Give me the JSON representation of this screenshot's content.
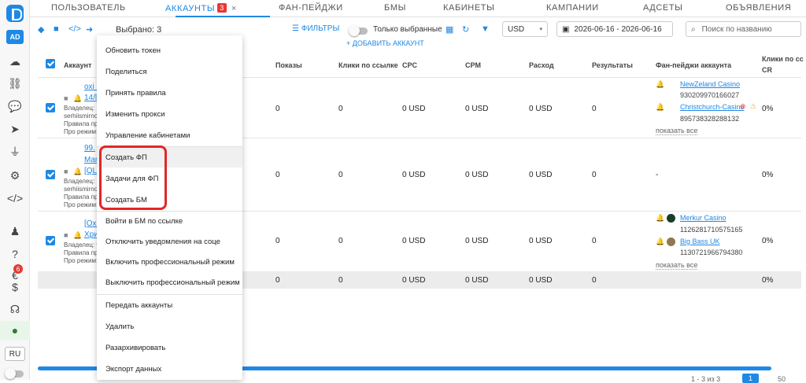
{
  "sidebar": {
    "ad_label": "AD",
    "ru_label": "RU",
    "badge_count": "6",
    "icons": [
      "cloud-upload-icon",
      "hierarchy-icon",
      "chat-icon",
      "cursor-icon",
      "plug-icon",
      "gear-icon",
      "code-icon",
      "user-spy-icon",
      "help-icon",
      "euro-icon",
      "dollar-icon",
      "headset-icon",
      "bulb-icon"
    ]
  },
  "tabs": [
    {
      "label": "ПОЛЬЗОВАТЕЛЬ"
    },
    {
      "label": "АККАУНТЫ",
      "badge": "3",
      "close": "×"
    },
    {
      "label": "ФАН-ПЕЙДЖИ"
    },
    {
      "label": "БМЫ"
    },
    {
      "label": "КАБИНЕТЫ"
    },
    {
      "label": "КАМПАНИИ"
    },
    {
      "label": "АДСЕТЫ"
    },
    {
      "label": "ОБЪЯВЛЕНИЯ"
    }
  ],
  "toolbar": {
    "selected": "Выбрано: 3",
    "filters": "ФИЛЬТРЫ",
    "only_selected": "Только выбранные",
    "add_account": "+ ДОБАВИТЬ АККАУНТ",
    "currency": "USD",
    "date_range": "2026-06-16 - 2026-06-16",
    "search_placeholder": "Поиск по названию"
  },
  "table": {
    "headers": {
      "account": "Аккаунт",
      "impressions": "Показы",
      "clicks": "Клики по ссылке",
      "cpc": "CPC",
      "cpm": "CPM",
      "spend": "Расход",
      "results": "Результаты",
      "fanpages": "Фан-пейджи аккаунта",
      "clicks_cut": "Клики по сс",
      "cr": "CR"
    },
    "rows": [
      {
        "name1": "oxi l",
        "name2": "14/l",
        "owner": "Владелец:",
        "owner_name": "serhiismirnov",
        "rules": "Правила пра",
        "pro": "Про режим:",
        "impressions": "0",
        "clicks": "0",
        "cpc": "0 USD",
        "cpm": "0 USD",
        "spend": "0 USD",
        "results": "0",
        "fp": [
          {
            "name": "NewZeland Casino",
            "id": "930209970166027"
          },
          {
            "name": "Christchurch-Casino",
            "id": "895738328288132"
          }
        ],
        "show_all": "показать все",
        "cr": "0%"
      },
      {
        "name1": "99.",
        "name2": "Mar",
        "name3": "[QL",
        "owner": "Владелец:",
        "owner_name": "serhiismirnov",
        "rules": "Правила пра",
        "pro": "Про режим:",
        "impressions": "0",
        "clicks": "0",
        "cpc": "0 USD",
        "cpm": "0 USD",
        "spend": "0 USD",
        "results": "0",
        "fp_empty": "-",
        "cr": "0%"
      },
      {
        "name1": "[Oxo",
        "name2": "Хри",
        "owner": "Владелец: w",
        "rules": "Правила пра",
        "pro": "Про режим:",
        "impressions": "0",
        "clicks": "0",
        "cpc": "0 USD",
        "cpm": "0 USD",
        "spend": "0 USD",
        "results": "0",
        "fp": [
          {
            "name": "Merkur Casino",
            "id": "1126281710575165"
          },
          {
            "name": "Big Bass UK",
            "id": "1130721966794380"
          }
        ],
        "show_all": "показать все",
        "cr": "0%"
      }
    ],
    "total": {
      "impressions": "0",
      "clicks": "0",
      "cpc": "0 USD",
      "cpm": "0 USD",
      "spend": "0 USD",
      "results": "0",
      "cr": "0%"
    }
  },
  "context_menu": {
    "items": [
      "Обновить токен",
      "Поделиться",
      "Принять правила",
      "Изменить прокси",
      "Управление кабинетами",
      "Создать ФП",
      "Задачи для ФП",
      "Создать БМ",
      "Войти в БМ по ссылке",
      "Отключить уведомления на соце",
      "Включить профессиональный режим",
      "Выключить профессиональный режим",
      "Передать аккаунты",
      "Удалить",
      "Разархивировать",
      "Экспорт данных"
    ]
  },
  "pagination": {
    "range": "1 - 3 из 3",
    "page": "1",
    "per_page": "50"
  },
  "colors": {
    "accent": "#1e88e5",
    "highlight": "#e32626"
  }
}
